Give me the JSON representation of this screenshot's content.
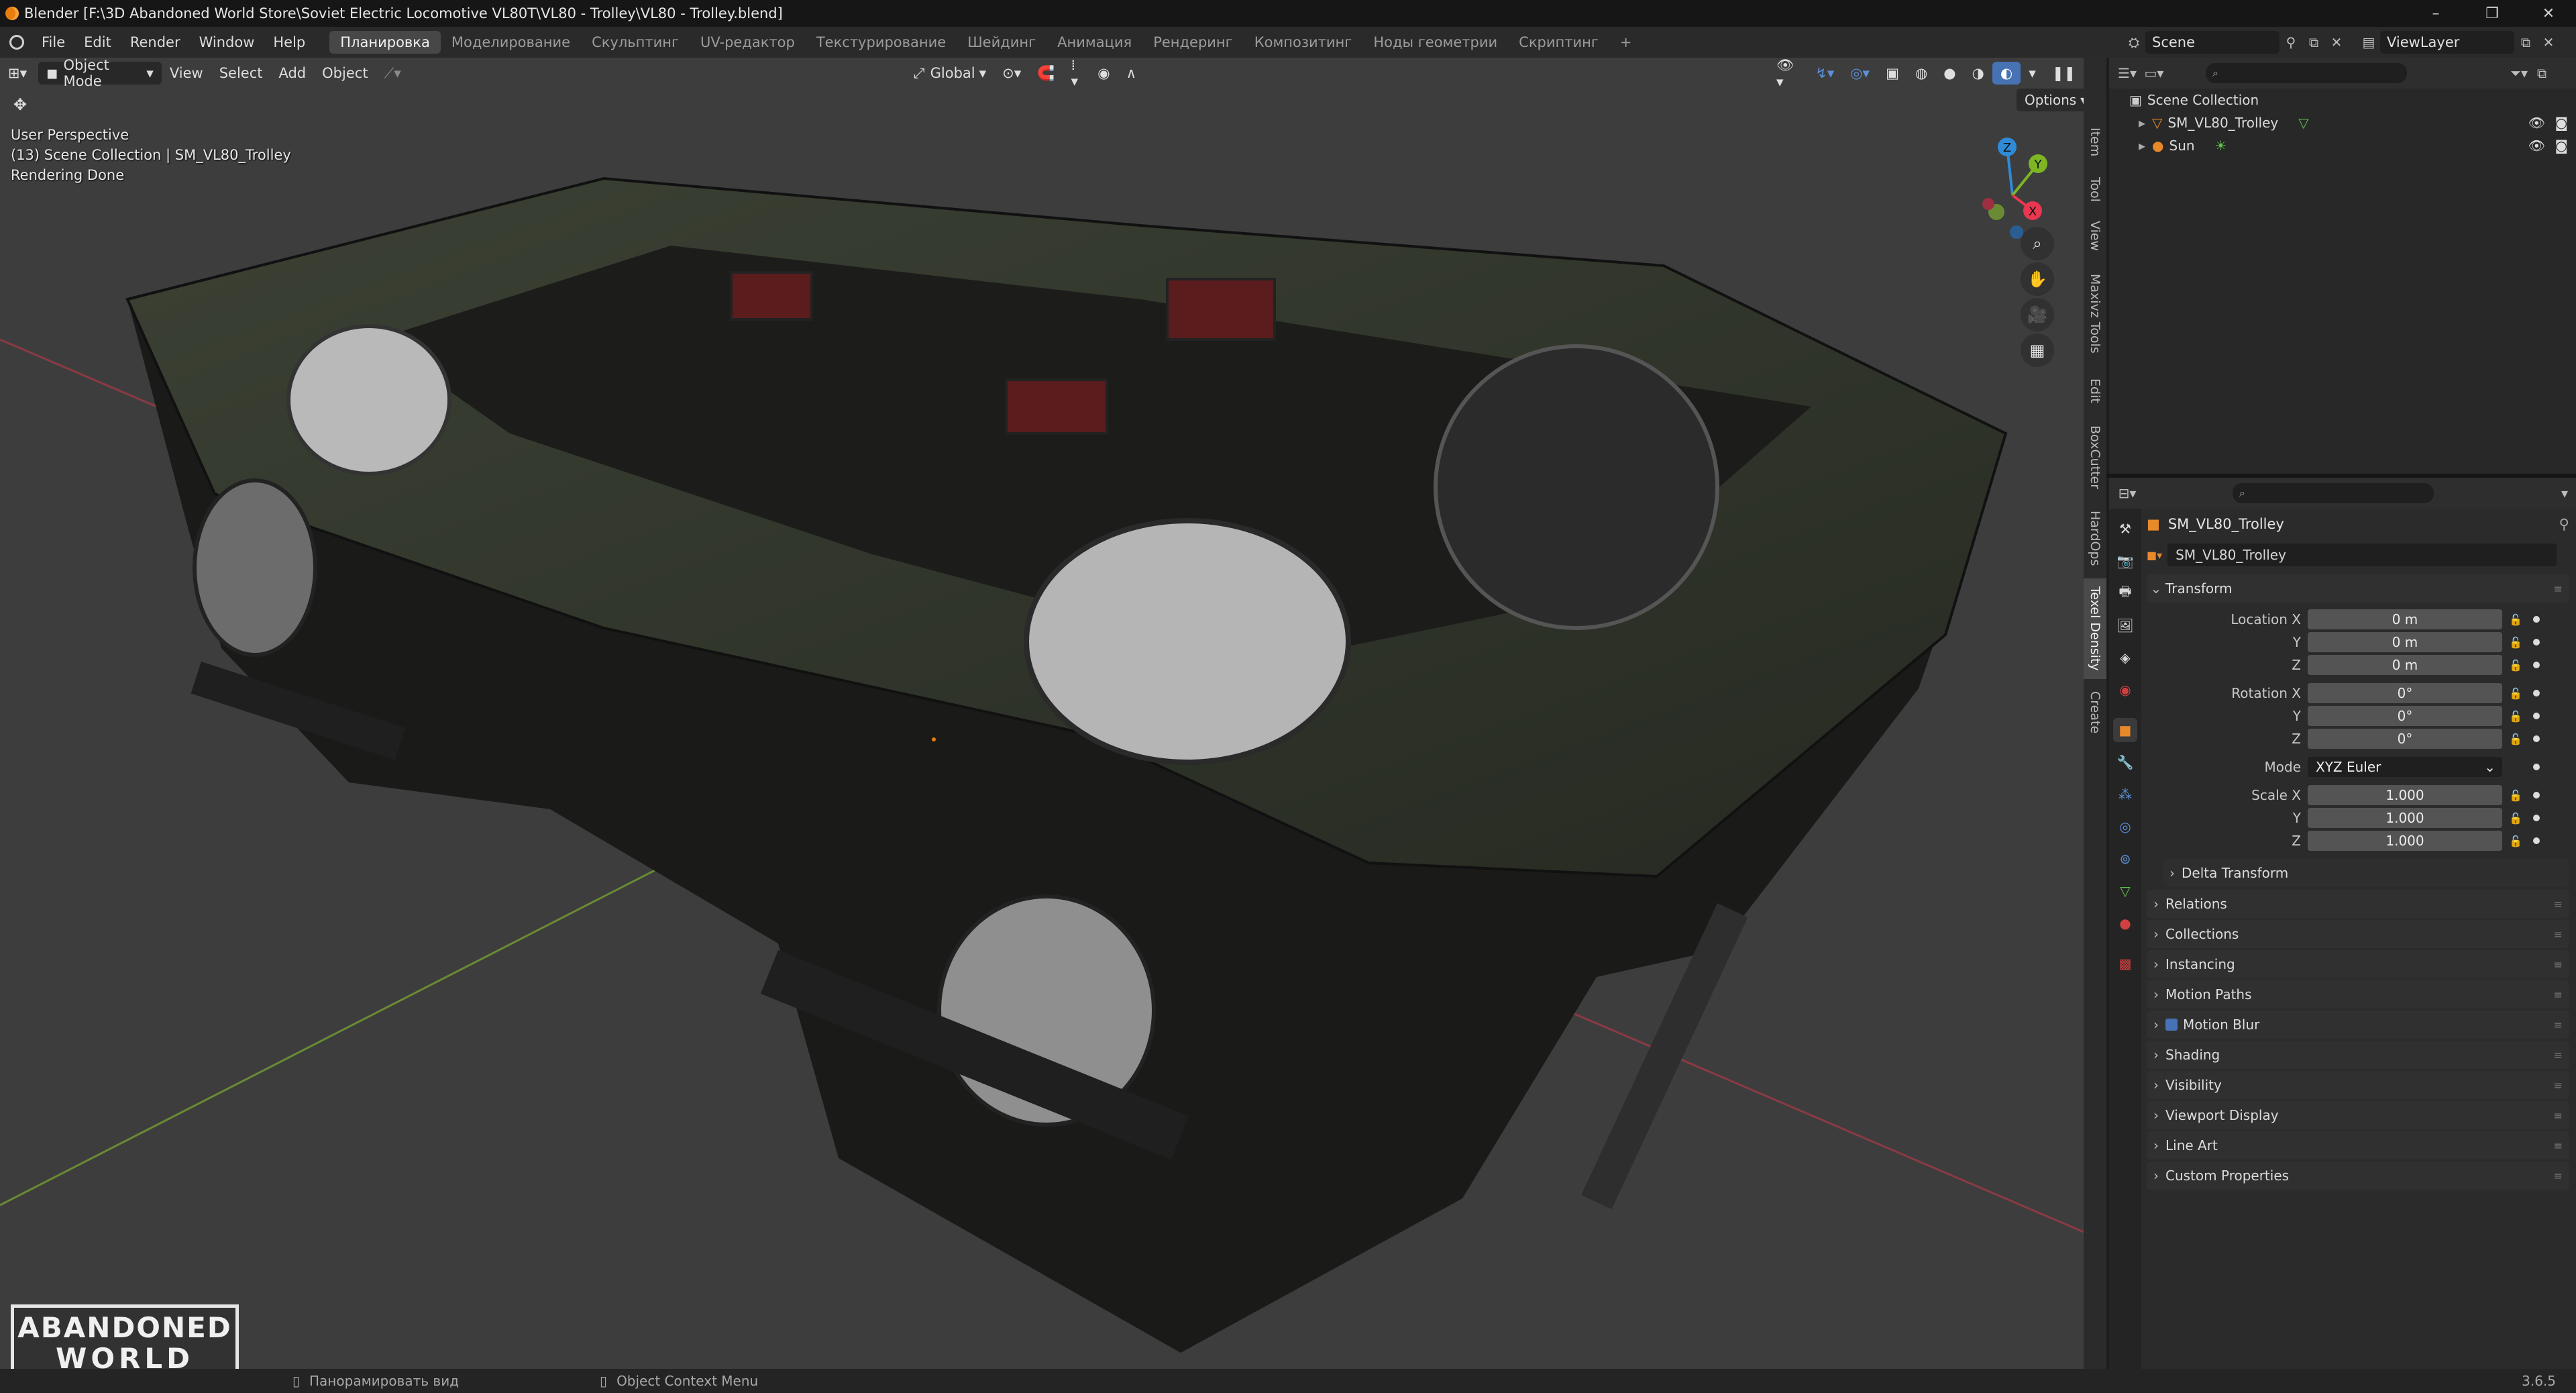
{
  "titlebar": {
    "title": "Blender [F:\\3D Abandoned World Store\\Soviet Electric Locomotive VL80T\\VL80 - Trolley\\VL80 - Trolley.blend]"
  },
  "menu": {
    "items": [
      "File",
      "Edit",
      "Render",
      "Window",
      "Help"
    ]
  },
  "workspaces": {
    "tabs": [
      "Планировка",
      "Моделирование",
      "Скульптинг",
      "UV-редактор",
      "Текстурирование",
      "Шейдинг",
      "Анимация",
      "Рендеринг",
      "Композитинг",
      "Ноды геометрии",
      "Скриптинг"
    ],
    "active": "Планировка",
    "add": "+"
  },
  "scene": {
    "name": "Scene",
    "view_layer": "ViewLayer"
  },
  "viewport": {
    "mode": "Object Mode",
    "menus": [
      "View",
      "Select",
      "Add",
      "Object"
    ],
    "orientation": "Global",
    "options": "Options",
    "overlay_lines": [
      "User Perspective",
      "(13) Scene Collection | SM_VL80_Trolley",
      "Rendering Done"
    ],
    "gizmo": {
      "z": "Z",
      "y": "Y",
      "x": "X"
    },
    "side_tabs": [
      "Item",
      "Tool",
      "View",
      "Maxivz Tools",
      "Edit",
      "BoxCutter",
      "HardOps",
      "Texel Density",
      "Create"
    ],
    "active_side_tab": "Texel Density",
    "bg_color": "#3d3d3d"
  },
  "outliner": {
    "root": "Scene Collection",
    "items": [
      {
        "name": "SM_VL80_Trolley",
        "type": "mesh"
      },
      {
        "name": "Sun",
        "type": "light"
      }
    ]
  },
  "properties": {
    "object_name": "SM_VL80_Trolley",
    "data_name": "SM_VL80_Trolley",
    "transform_label": "Transform",
    "location": {
      "label": "Location X",
      "x": "0 m",
      "y": "0 m",
      "z": "0 m"
    },
    "rotation": {
      "label": "Rotation X",
      "x": "0°",
      "y": "0°",
      "z": "0°"
    },
    "mode": {
      "label": "Mode",
      "value": "XYZ Euler"
    },
    "scale": {
      "label": "Scale X",
      "x": "1.000",
      "y": "1.000",
      "z": "1.000"
    },
    "axis_labels": {
      "y": "Y",
      "z": "Z"
    },
    "delta": "Delta Transform",
    "panels": [
      "Relations",
      "Collections",
      "Instancing",
      "Motion Paths",
      "Motion Blur",
      "Shading",
      "Visibility",
      "Viewport Display",
      "Line Art",
      "Custom Properties"
    ]
  },
  "statusbar": {
    "hint1": "Панорамировать вид",
    "hint2": "Object Context Menu",
    "version": "3.6.5"
  },
  "watermark": {
    "line1": "ABANDONED",
    "line2": "WORLD"
  },
  "colors": {
    "accent": "#4772b3",
    "orange": "#e87d0d",
    "x_axis": "#e8374f",
    "y_axis": "#7db524",
    "z_axis": "#2f8bd8"
  }
}
